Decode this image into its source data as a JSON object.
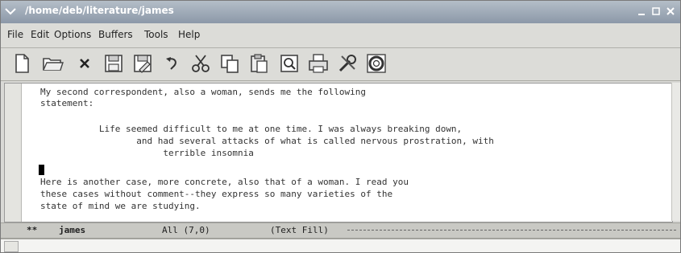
{
  "window": {
    "title": "/home/deb/literature/james"
  },
  "menubar": {
    "items": [
      "File",
      "Edit",
      "Options",
      "Buffers",
      "Tools",
      "Help"
    ]
  },
  "toolbar": {
    "icons": [
      "new-file",
      "open-folder",
      "close",
      "save",
      "save-as",
      "undo",
      "cut",
      "copy",
      "paste",
      "search",
      "print",
      "preferences",
      "help"
    ]
  },
  "editor": {
    "lines": [
      "My second correspondent, also a woman, sends me the following",
      "statement:",
      "",
      "           Life seemed difficult to me at one time. I was always breaking down,",
      "                  and had several attacks of what is called nervous prostration, with",
      "                       terrible insomnia",
      "",
      "Here is another case, more concrete, also that of a woman. I read you",
      "these cases without comment--they express so many varieties of the",
      "state of mind we are studying."
    ]
  },
  "modeline": {
    "status": "**",
    "buffer": "james",
    "position": "All (7,0)",
    "mode": "(Text Fill)"
  }
}
